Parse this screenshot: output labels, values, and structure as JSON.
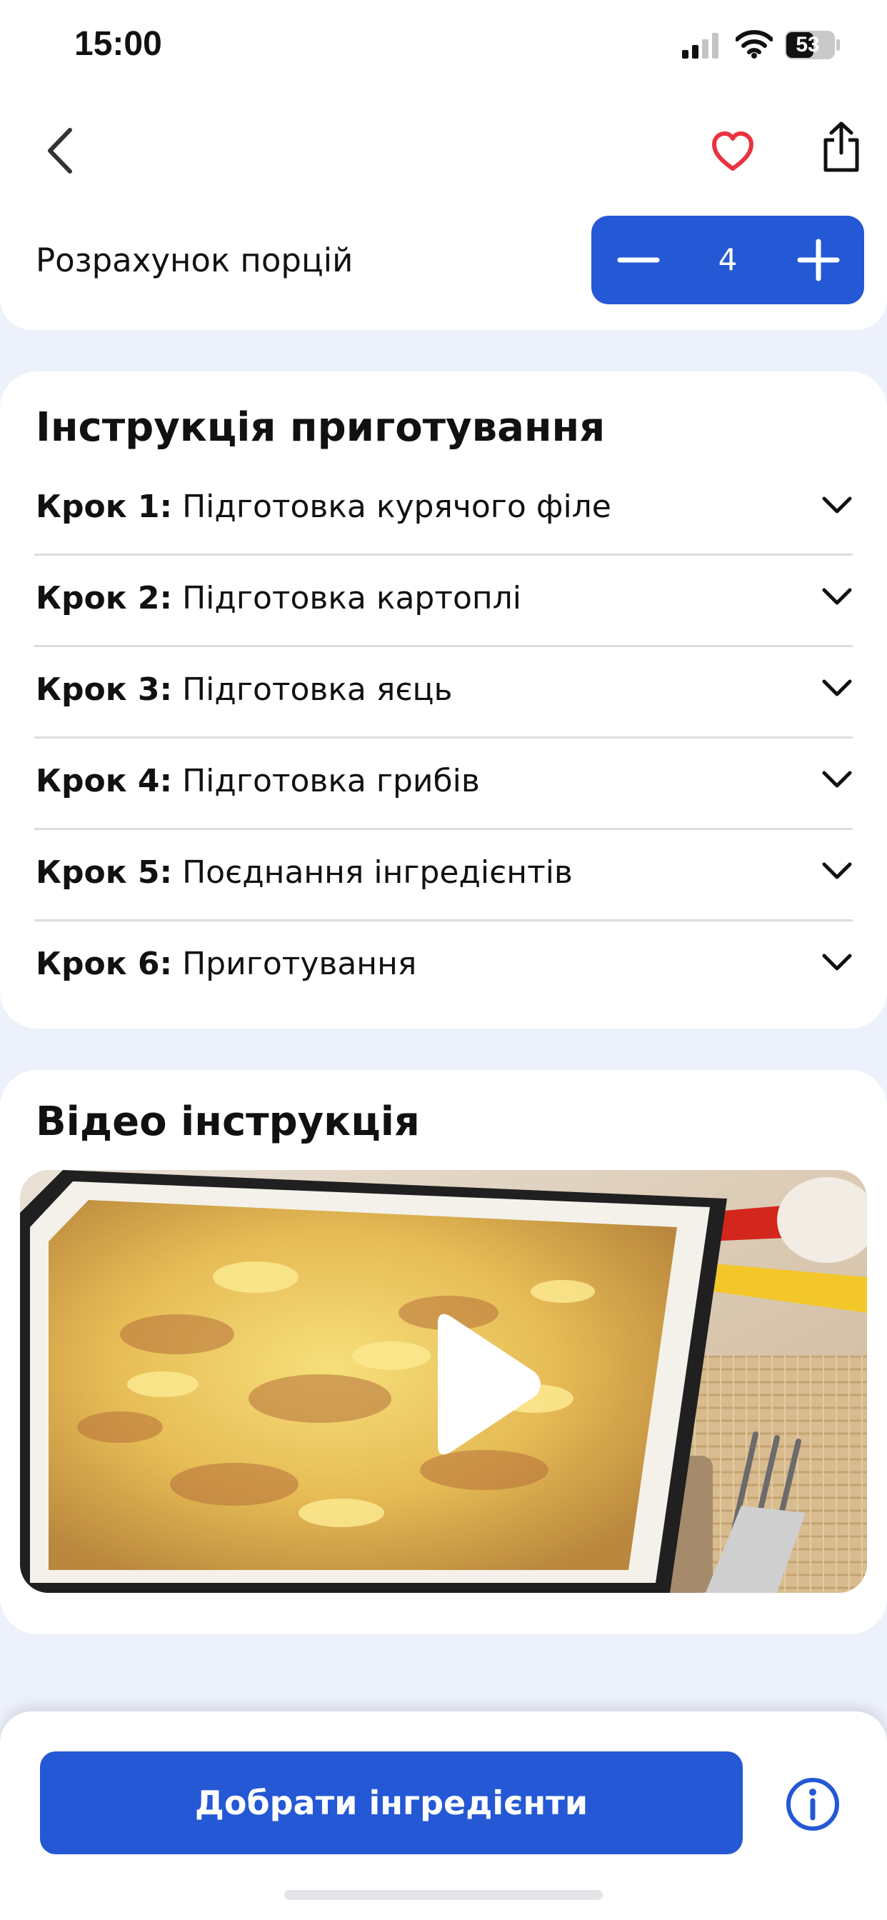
{
  "status_bar": {
    "time": "15:00",
    "battery_level": "53"
  },
  "header": {
    "icons": [
      "chevron-left-icon",
      "heart-icon",
      "share-icon"
    ],
    "heart_color": "#e8333f"
  },
  "portions": {
    "label": "Розрахунок порцій",
    "value": "4",
    "accent_color": "#2458d4"
  },
  "instructions": {
    "title": "Інструкція приготування",
    "steps": [
      {
        "number": "Крок 1:",
        "title": "Підготовка курячого філе"
      },
      {
        "number": "Крок 2:",
        "title": "Підготовка картоплі"
      },
      {
        "number": "Крок 3:",
        "title": "Підготовка яєць"
      },
      {
        "number": "Крок 4:",
        "title": "Підготовка грибів"
      },
      {
        "number": "Крок 5:",
        "title": "Поєднання інгредієнтів"
      },
      {
        "number": "Крок 6:",
        "title": "Приготування"
      }
    ]
  },
  "video": {
    "title": "Відео інструкція",
    "icon": "play-icon"
  },
  "footer": {
    "primary_button": "Добрати інгредієнти",
    "info_icon": "info-icon"
  }
}
